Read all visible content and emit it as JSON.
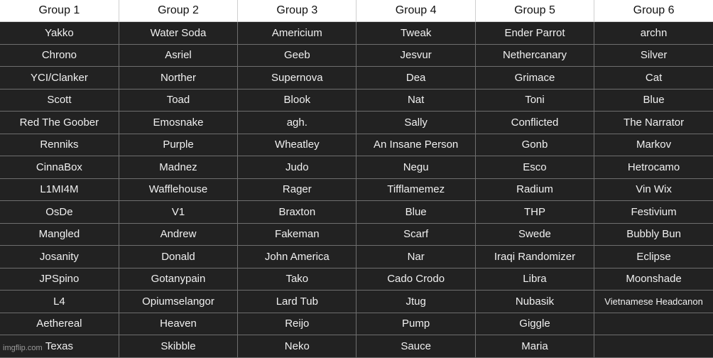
{
  "headers": [
    "Group 1",
    "Group 2",
    "Group 3",
    "Group 4",
    "Group 5",
    "Group 6"
  ],
  "rows": [
    [
      "Yakko",
      "Water Soda",
      "Americium",
      "Tweak",
      "Ender Parrot",
      "archn"
    ],
    [
      "Chrono",
      "Asriel",
      "Geeb",
      "Jesvur",
      "Nethercanary",
      "Silver"
    ],
    [
      "YCI/Clanker",
      "Norther",
      "Supernova",
      "Dea",
      "Grimace",
      "Cat"
    ],
    [
      "Scott",
      "Toad",
      "Blook",
      "Nat",
      "Toni",
      "Blue"
    ],
    [
      "Red The Goober",
      "Emosnake",
      "agh.",
      "Sally",
      "Conflicted",
      "The Narrator"
    ],
    [
      "Renniks",
      "Purple",
      "Wheatley",
      "An Insane Person",
      "Gonb",
      "Markov"
    ],
    [
      "CinnaBox",
      "Madnez",
      "Judo",
      "Negu",
      "Esco",
      "Hetrocamo"
    ],
    [
      "L1MI4M",
      "Wafflehouse",
      "Rager",
      "Tifflamemez",
      "Radium",
      "Vin Wix"
    ],
    [
      "OsDe",
      "V1",
      "Braxton",
      "Blue",
      "THP",
      "Festivium"
    ],
    [
      "Mangled",
      "Andrew",
      "Fakeman",
      "Scarf",
      "Swede",
      "Bubbly Bun"
    ],
    [
      "Josanity",
      "Donald",
      "John America",
      "Nar",
      "Iraqi Randomizer",
      "Eclipse"
    ],
    [
      "JPSpino",
      "Gotanypain",
      "Tako",
      "Cado Crodo",
      "Libra",
      "Moonshade"
    ],
    [
      "L4",
      "Opiumselangor",
      "Lard Tub",
      "Jtug",
      "Nubasik",
      "Vietnamese Headcanon"
    ],
    [
      "Aethereal",
      "Heaven",
      "Reijo",
      "Pump",
      "Giggle",
      ""
    ],
    [
      "Texas",
      "Skibble",
      "Neko",
      "Sauce",
      "Maria",
      ""
    ]
  ],
  "watermark": "imgflip.com"
}
